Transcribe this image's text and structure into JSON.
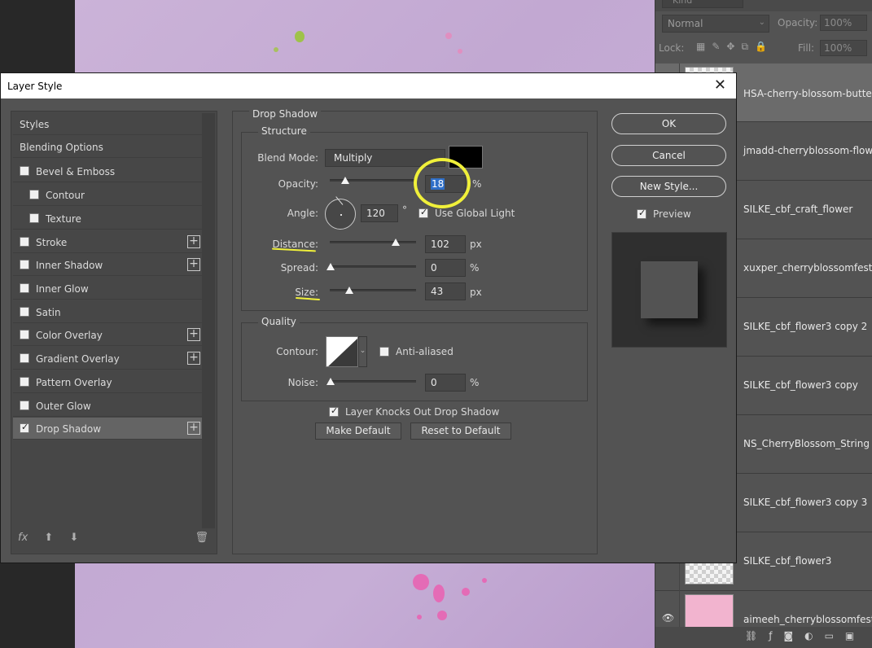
{
  "layers_panel": {
    "filter_kind": "Kind",
    "blend_mode": "Normal",
    "opacity_label": "Opacity:",
    "opacity_value": "100%",
    "lock_label": "Lock:",
    "fill_label": "Fill:",
    "fill_value": "100%",
    "layers": [
      "HSA-cherry-blossom-butterf",
      "jmadd-cherryblossom-flowe",
      "SILKE_cbf_craft_flower",
      "xuxper_cherryblossomfesti...",
      "SILKE_cbf_flower3 copy 2",
      "SILKE_cbf_flower3 copy",
      "NS_CherryBlossom_String",
      "SILKE_cbf_flower3 copy 3",
      "SILKE_cbf_flower3",
      "aimeeh_cherryblossomfest..."
    ]
  },
  "dialog": {
    "title": "Layer Style",
    "styles_list": [
      {
        "label": "Styles",
        "checkbox": false,
        "checked": false,
        "plus": false,
        "indent": false
      },
      {
        "label": "Blending Options",
        "checkbox": false,
        "checked": false,
        "plus": false,
        "indent": false
      },
      {
        "label": "Bevel & Emboss",
        "checkbox": true,
        "checked": false,
        "plus": false,
        "indent": false
      },
      {
        "label": "Contour",
        "checkbox": true,
        "checked": false,
        "plus": false,
        "indent": true
      },
      {
        "label": "Texture",
        "checkbox": true,
        "checked": false,
        "plus": false,
        "indent": true
      },
      {
        "label": "Stroke",
        "checkbox": true,
        "checked": false,
        "plus": true,
        "indent": false
      },
      {
        "label": "Inner Shadow",
        "checkbox": true,
        "checked": false,
        "plus": true,
        "indent": false
      },
      {
        "label": "Inner Glow",
        "checkbox": true,
        "checked": false,
        "plus": false,
        "indent": false
      },
      {
        "label": "Satin",
        "checkbox": true,
        "checked": false,
        "plus": false,
        "indent": false
      },
      {
        "label": "Color Overlay",
        "checkbox": true,
        "checked": false,
        "plus": true,
        "indent": false
      },
      {
        "label": "Gradient Overlay",
        "checkbox": true,
        "checked": false,
        "plus": true,
        "indent": false
      },
      {
        "label": "Pattern Overlay",
        "checkbox": true,
        "checked": false,
        "plus": false,
        "indent": false
      },
      {
        "label": "Outer Glow",
        "checkbox": true,
        "checked": false,
        "plus": false,
        "indent": false
      },
      {
        "label": "Drop Shadow",
        "checkbox": true,
        "checked": true,
        "plus": true,
        "indent": false
      }
    ],
    "footer_fx": "fx",
    "section_title": "Drop Shadow",
    "structure": {
      "title": "Structure",
      "blend_mode_label": "Blend Mode:",
      "blend_mode_value": "Multiply",
      "shadow_color": "#000000",
      "opacity_label": "Opacity:",
      "opacity_value": "18",
      "opacity_unit": "%",
      "opacity_level": 0.18,
      "angle_label": "Angle:",
      "angle_value": "120",
      "angle_unit": "°",
      "global_light_label": "Use Global Light",
      "global_light_checked": true,
      "distance_label": "Distance:",
      "distance_value": "102",
      "distance_unit": "px",
      "spread_label": "Spread:",
      "spread_value": "0",
      "spread_unit": "%",
      "size_label": "Size:",
      "size_value": "43",
      "size_unit": "px"
    },
    "quality": {
      "title": "Quality",
      "contour_label": "Contour:",
      "anti_aliased_label": "Anti-aliased",
      "anti_aliased_checked": false,
      "noise_label": "Noise:",
      "noise_value": "0",
      "noise_unit": "%"
    },
    "knockout_label": "Layer Knocks Out Drop Shadow",
    "knockout_checked": true,
    "make_default_label": "Make Default",
    "reset_default_label": "Reset to Default",
    "ok_label": "OK",
    "cancel_label": "Cancel",
    "new_style_label": "New Style...",
    "preview_label": "Preview",
    "preview_checked": true
  },
  "colors": {
    "annotation_highlight": "#f0f03a",
    "dialog_bg": "#535353"
  }
}
